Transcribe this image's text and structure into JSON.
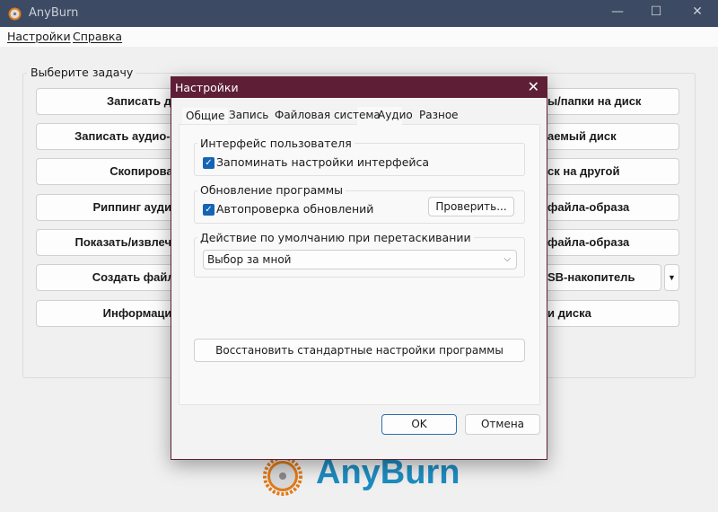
{
  "window": {
    "title": "AnyBurn",
    "minimize": "—",
    "maximize": "☐",
    "close": "✕"
  },
  "menu": [
    "Настройки",
    "Справка"
  ],
  "main": {
    "group_label": "Выберите задачу",
    "left_buttons": [
      "Записать ди",
      "Записать аудио-С",
      "Скопироват",
      "Риппинг аудио",
      "Показать/извлечь",
      "Создать файл-",
      "Информация"
    ],
    "right_buttons": [
      "ы/папки на диск",
      "аемый диск",
      "ск на другой",
      "файла-образа",
      "файла-образа",
      "SB-накопитель",
      "и диска"
    ],
    "dropdown_arrow": "▼"
  },
  "dialog": {
    "title": "Настройки",
    "close": "✕",
    "tabs": [
      "Общие",
      "Запись",
      "Файловая система",
      "Аудио",
      "Разное"
    ],
    "ui_group": {
      "label": "Интерфейс пользователя",
      "checkbox": "Запоминать настройки интерфейса",
      "checked": true
    },
    "update_group": {
      "label": "Обновление программы",
      "checkbox": "Автопроверка обновлений",
      "checked": true,
      "button": "Проверить..."
    },
    "drag_group": {
      "label": "Действие по умолчанию при перетаскивании",
      "select_value": "Выбор за мной"
    },
    "restore_button": "Восстановить стандартные настройки программы",
    "ok": "OK",
    "cancel": "Отмена"
  },
  "logo": {
    "text": "AnyBurn"
  },
  "colors": {
    "titlebar": "#3d4a63",
    "dialog_title": "#5e1f36",
    "accent": "#1664b4",
    "logo_blue": "#1e8cc0",
    "logo_orange": "#e07a1a"
  }
}
